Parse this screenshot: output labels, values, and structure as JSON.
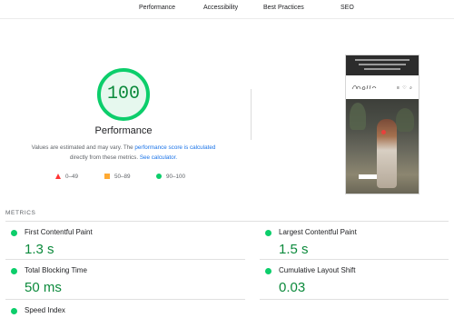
{
  "nav": {
    "tabs": [
      "Performance",
      "Accessibility",
      "Best Practices",
      "SEO"
    ]
  },
  "score": {
    "value": "100",
    "fraction": 1.0,
    "category": "Performance",
    "ring_color": "#0cce6b",
    "text_color": "#0c8a3c",
    "fill_color": "#e6f8ee"
  },
  "disclaimer": {
    "prefix": "Values are estimated and may vary. The ",
    "link1": "performance score is calculated",
    "middle": " directly from these metrics. ",
    "link2": "See calculator."
  },
  "legend": [
    {
      "range": "0–49",
      "icon": "triangle-icon",
      "color": "#ff3333"
    },
    {
      "range": "50–89",
      "icon": "square-icon",
      "color": "#ffaa33"
    },
    {
      "range": "90–100",
      "icon": "circle-icon",
      "color": "#0cce6b"
    }
  ],
  "metrics": {
    "title": "METRICS",
    "items": [
      {
        "label": "First Contentful Paint",
        "value": "1.3 s"
      },
      {
        "label": "Largest Contentful Paint",
        "value": "1.5 s"
      },
      {
        "label": "Total Blocking Time",
        "value": "50 ms"
      },
      {
        "label": "Cumulative Layout Shift",
        "value": "0.03"
      },
      {
        "label": "Speed Index",
        "value": ""
      }
    ]
  }
}
